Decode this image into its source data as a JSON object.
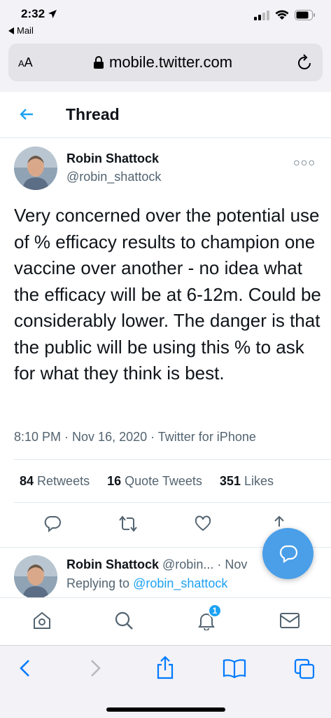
{
  "status_bar": {
    "time": "2:32",
    "back_app": "Mail"
  },
  "browser": {
    "text_size_label": "AA",
    "url": "mobile.twitter.com"
  },
  "header": {
    "title": "Thread"
  },
  "tweet": {
    "author_name": "Robin Shattock",
    "author_handle": "@robin_shattock",
    "text": "Very concerned over the potential use of % efficacy results to champion one vaccine over another - no idea what the efficacy will be at 6-12m. Could be considerably lower. The danger is that the public will be using this % to ask for what they think is best.",
    "time": "8:10 PM",
    "date": "Nov 16, 2020",
    "source": "Twitter for iPhone",
    "retweets_count": "84",
    "retweets_label": "Retweets",
    "quotes_count": "16",
    "quotes_label": "Quote Tweets",
    "likes_count": "351",
    "likes_label": "Likes"
  },
  "reply": {
    "author_name": "Robin Shattock",
    "author_handle_truncated": "@robin...",
    "date_truncated": "Nov",
    "replying_prefix": "Replying to",
    "replying_handle": "@robin_shattock"
  },
  "bottom_nav": {
    "notifications_badge": "1"
  },
  "colors": {
    "accent": "#1da1f2",
    "fab": "#4a9fe8",
    "ios_blue": "#007aff"
  }
}
